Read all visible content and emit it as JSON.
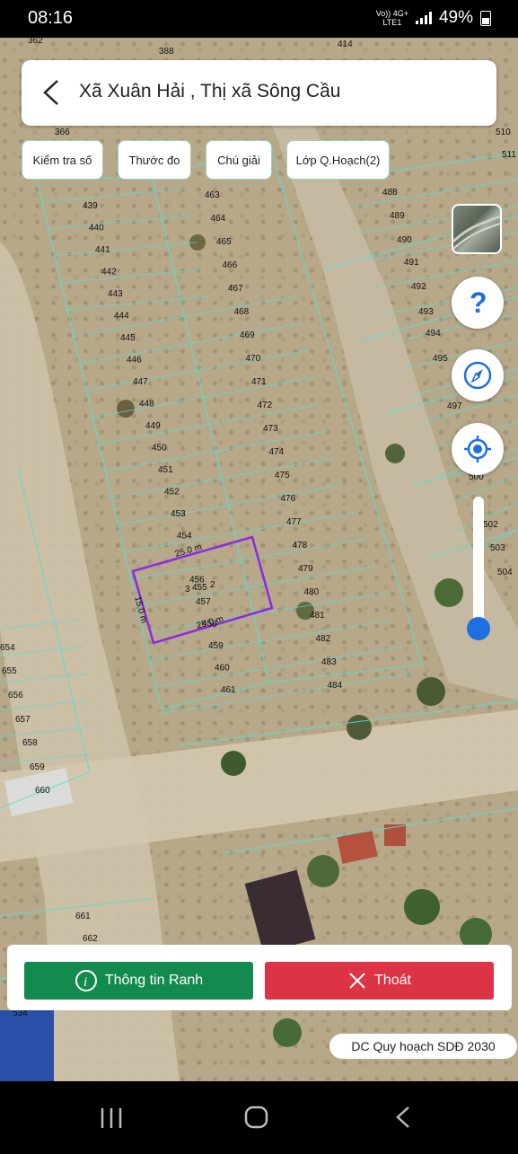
{
  "status_bar": {
    "time": "08:16",
    "network_top": "Vo)) 4G+",
    "network_bottom": "LTE1",
    "battery": "49%"
  },
  "header": {
    "title": "Xã Xuân Hải , Thị xã Sông Cầu"
  },
  "tools": [
    {
      "label": "Kiểm tra số"
    },
    {
      "label": "Thước đo"
    },
    {
      "label": "Chú giải"
    },
    {
      "label": "Lớp Q.Hoạch(2)"
    }
  ],
  "map": {
    "selected_parcel": {
      "number": "455",
      "number_prefix": "3",
      "number_suffix": "2",
      "top_edge": "25.0 m",
      "bottom_edge": "25.0 m",
      "left_edge": "15.0 m",
      "outline_color": "#8a2be2"
    },
    "parcel_labels_left_column": [
      "439",
      "440",
      "441",
      "442",
      "443",
      "444",
      "445",
      "446",
      "447",
      "448",
      "449",
      "450",
      "451",
      "452",
      "453",
      "454",
      "456",
      "457",
      "458",
      "459",
      "460",
      "461"
    ],
    "parcel_labels_middle_column": [
      "463",
      "464",
      "465",
      "466",
      "467",
      "468",
      "469",
      "470",
      "471",
      "472",
      "473",
      "474",
      "475",
      "476",
      "477",
      "478",
      "479",
      "480",
      "481",
      "482",
      "483",
      "484"
    ],
    "parcel_labels_right_column": [
      "488",
      "489",
      "490",
      "491",
      "492",
      "493",
      "494",
      "495",
      "497",
      "500",
      "502",
      "503",
      "504"
    ],
    "parcel_labels_bottom_left": [
      "654",
      "655",
      "656",
      "657",
      "658",
      "659",
      "660",
      "661",
      "662",
      "534"
    ],
    "parcel_labels_top": [
      "362",
      "388",
      "414",
      "366",
      "510",
      "511"
    ],
    "zoom_level": 0.08
  },
  "controls": {
    "layer_icon": "satellite-layer-icon",
    "help_icon": "question-icon",
    "compass_icon": "compass-icon",
    "locate_icon": "locate-icon",
    "accent_color": "#1e6fe0"
  },
  "actions": {
    "info_label": "Thông tin Ranh",
    "exit_label": "Thoát",
    "info_color": "#138a4e",
    "exit_color": "#dc3444"
  },
  "legend": {
    "label": "DC Quy hoạch SDĐ 2030"
  }
}
